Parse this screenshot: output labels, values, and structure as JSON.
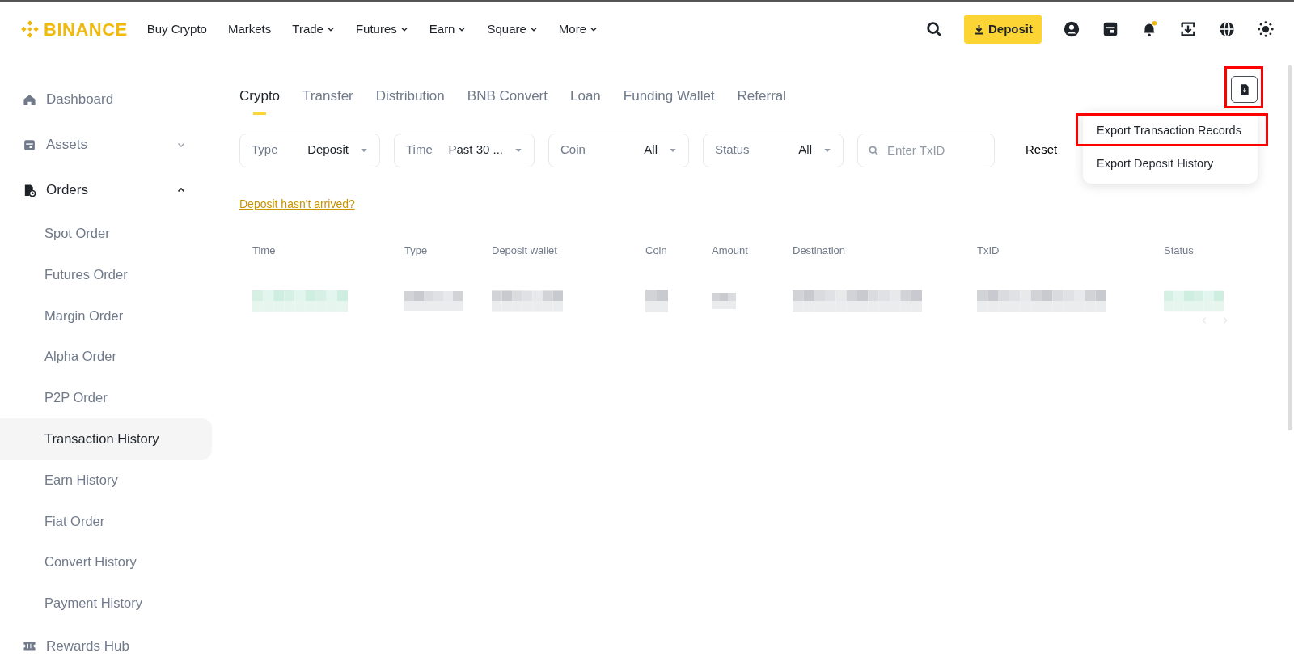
{
  "navbar": {
    "logo": "BINANCE",
    "items": [
      {
        "label": "Buy Crypto",
        "dropdown": false
      },
      {
        "label": "Markets",
        "dropdown": false
      },
      {
        "label": "Trade",
        "dropdown": true
      },
      {
        "label": "Futures",
        "dropdown": true
      },
      {
        "label": "Earn",
        "dropdown": true
      },
      {
        "label": "Square",
        "dropdown": true
      },
      {
        "label": "More",
        "dropdown": true
      }
    ],
    "deposit_button": "Deposit",
    "notification_dot": true
  },
  "sidebar": {
    "items": [
      {
        "label": "Dashboard"
      },
      {
        "label": "Assets",
        "expanded": false
      },
      {
        "label": "Orders",
        "expanded": true,
        "children": [
          {
            "label": "Spot Order",
            "selected": false
          },
          {
            "label": "Futures Order",
            "selected": false
          },
          {
            "label": "Margin Order",
            "selected": false
          },
          {
            "label": "Alpha Order",
            "selected": false
          },
          {
            "label": "P2P Order",
            "selected": false
          },
          {
            "label": "Transaction History",
            "selected": true
          },
          {
            "label": "Earn History",
            "selected": false
          },
          {
            "label": "Fiat Order",
            "selected": false
          },
          {
            "label": "Convert History",
            "selected": false
          },
          {
            "label": "Payment History",
            "selected": false
          }
        ]
      },
      {
        "label": "Rewards Hub"
      }
    ]
  },
  "tabs": [
    {
      "label": "Crypto",
      "selected": true
    },
    {
      "label": "Transfer",
      "selected": false
    },
    {
      "label": "Distribution",
      "selected": false
    },
    {
      "label": "BNB Convert",
      "selected": false
    },
    {
      "label": "Loan",
      "selected": false
    },
    {
      "label": "Funding Wallet",
      "selected": false
    },
    {
      "label": "Referral",
      "selected": false
    }
  ],
  "filters": [
    {
      "label": "Type",
      "value": "Deposit"
    },
    {
      "label": "Time",
      "value": "Past 30 ..."
    },
    {
      "label": "Coin",
      "value": "All"
    },
    {
      "label": "Status",
      "value": "All"
    }
  ],
  "search": {
    "placeholder": "Enter TxID"
  },
  "reset_button": "Reset",
  "help_link": "Deposit hasn't arrived?",
  "export": {
    "highlighted": true,
    "menu": [
      {
        "label": "Export Transaction Records",
        "highlighted": true
      },
      {
        "label": "Export Deposit History",
        "highlighted": false
      }
    ]
  },
  "table": {
    "columns": [
      "Time",
      "Type",
      "Deposit wallet",
      "Coin",
      "Amount",
      "Destination",
      "TxID",
      "Status"
    ],
    "rows": [
      {
        "kind": "redacted"
      }
    ]
  },
  "pagination": {
    "prev_disabled": true,
    "next_disabled": true
  }
}
